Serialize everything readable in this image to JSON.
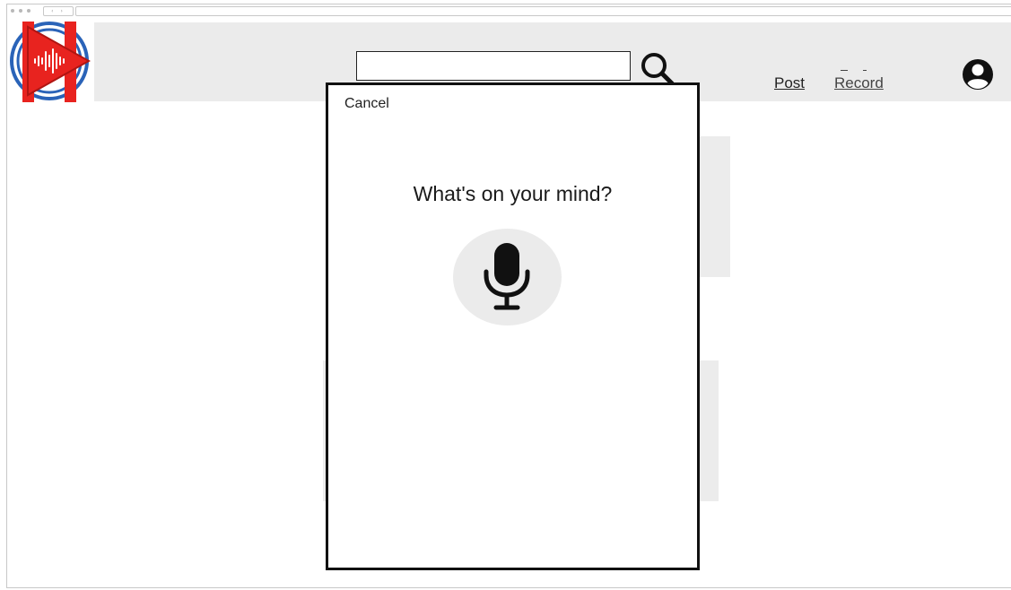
{
  "header": {
    "search": {
      "value": "",
      "placeholder": ""
    },
    "nav": {
      "post_label": "Post",
      "record_label": "Record"
    }
  },
  "modal": {
    "cancel_label": "Cancel",
    "prompt": "What's on your mind?"
  },
  "icons": {
    "logo": "audio-play-logo",
    "search": "search-icon",
    "account": "account-icon",
    "mic": "microphone-icon"
  },
  "colors": {
    "header_bg": "#ebebeb",
    "logo_red": "#e8231f",
    "logo_blue": "#2a63b8",
    "modal_border": "#111111",
    "mic_bg": "#ebebeb"
  }
}
